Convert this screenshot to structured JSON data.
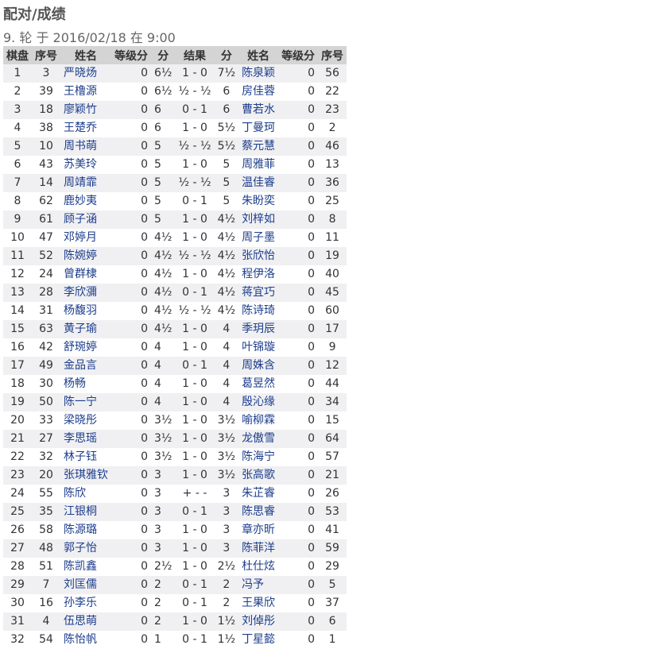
{
  "page": {
    "title": "配对/成绩",
    "round_info": "9. 轮 于 2016/02/18 在 9:00"
  },
  "table": {
    "headers": [
      "棋盘",
      "序号",
      "姓名",
      "等级分",
      "分",
      "结果",
      "分",
      "姓名",
      "等级分",
      "序号"
    ],
    "rows": [
      [
        "1",
        "3",
        "严晓炀",
        "0",
        "6½",
        "1 - 0",
        "7½",
        "陈泉颖",
        "0",
        "56"
      ],
      [
        "2",
        "39",
        "王橹源",
        "0",
        "6½",
        "½ - ½",
        "6",
        "房佳蓉",
        "0",
        "22"
      ],
      [
        "3",
        "18",
        "廖颖竹",
        "0",
        "6",
        "0 - 1",
        "6",
        "曹若水",
        "0",
        "23"
      ],
      [
        "4",
        "38",
        "王楚乔",
        "0",
        "6",
        "1 - 0",
        "5½",
        "丁曼珂",
        "0",
        "2"
      ],
      [
        "5",
        "10",
        "周书萌",
        "0",
        "5",
        "½ - ½",
        "5½",
        "蔡元慧",
        "0",
        "46"
      ],
      [
        "6",
        "43",
        "苏美玲",
        "0",
        "5",
        "1 - 0",
        "5",
        "周雅菲",
        "0",
        "13"
      ],
      [
        "7",
        "14",
        "周靖霏",
        "0",
        "5",
        "½ - ½",
        "5",
        "温佳睿",
        "0",
        "36"
      ],
      [
        "8",
        "62",
        "鹿妙夷",
        "0",
        "5",
        "0 - 1",
        "5",
        "朱盼奕",
        "0",
        "25"
      ],
      [
        "9",
        "61",
        "顾子涵",
        "0",
        "5",
        "1 - 0",
        "4½",
        "刘梓如",
        "0",
        "8"
      ],
      [
        "10",
        "47",
        "邓婷月",
        "0",
        "4½",
        "1 - 0",
        "4½",
        "周子墨",
        "0",
        "11"
      ],
      [
        "11",
        "52",
        "陈婉婷",
        "0",
        "4½",
        "½ - ½",
        "4½",
        "张欣怡",
        "0",
        "19"
      ],
      [
        "12",
        "24",
        "曾群棣",
        "0",
        "4½",
        "1 - 0",
        "4½",
        "程伊洛",
        "0",
        "40"
      ],
      [
        "13",
        "28",
        "李欣瀰",
        "0",
        "4½",
        "0 - 1",
        "4½",
        "蒋宜巧",
        "0",
        "45"
      ],
      [
        "14",
        "31",
        "杨馥羽",
        "0",
        "4½",
        "½ - ½",
        "4½",
        "陈诗琦",
        "0",
        "60"
      ],
      [
        "15",
        "63",
        "黄子瑜",
        "0",
        "4½",
        "1 - 0",
        "4",
        "季玥辰",
        "0",
        "17"
      ],
      [
        "16",
        "42",
        "舒琬婷",
        "0",
        "4",
        "1 - 0",
        "4",
        "叶锦璇",
        "0",
        "9"
      ],
      [
        "17",
        "49",
        "金品言",
        "0",
        "4",
        "0 - 1",
        "4",
        "周姝含",
        "0",
        "12"
      ],
      [
        "18",
        "30",
        "杨畅",
        "0",
        "4",
        "1 - 0",
        "4",
        "葛昱然",
        "0",
        "44"
      ],
      [
        "19",
        "50",
        "陈一宁",
        "0",
        "4",
        "1 - 0",
        "4",
        "殷沁缘",
        "0",
        "34"
      ],
      [
        "20",
        "33",
        "梁晓彤",
        "0",
        "3½",
        "1 - 0",
        "3½",
        "喻柳霖",
        "0",
        "15"
      ],
      [
        "21",
        "27",
        "李思瑶",
        "0",
        "3½",
        "1 - 0",
        "3½",
        "龙傲雪",
        "0",
        "64"
      ],
      [
        "22",
        "32",
        "林子钰",
        "0",
        "3½",
        "1 - 0",
        "3½",
        "陈海宁",
        "0",
        "57"
      ],
      [
        "23",
        "20",
        "张琪雅钦",
        "0",
        "3",
        "1 - 0",
        "3½",
        "张高歌",
        "0",
        "21"
      ],
      [
        "24",
        "55",
        "陈欣",
        "0",
        "3",
        "+ - -",
        "3",
        "朱芷睿",
        "0",
        "26"
      ],
      [
        "25",
        "35",
        "江银桐",
        "0",
        "3",
        "0 - 1",
        "3",
        "陈思睿",
        "0",
        "53"
      ],
      [
        "26",
        "58",
        "陈源璐",
        "0",
        "3",
        "1 - 0",
        "3",
        "章亦昕",
        "0",
        "41"
      ],
      [
        "27",
        "48",
        "郭子怡",
        "0",
        "3",
        "1 - 0",
        "3",
        "陈菲洋",
        "0",
        "59"
      ],
      [
        "28",
        "51",
        "陈凯鑫",
        "0",
        "2½",
        "1 - 0",
        "2½",
        "杜仕炫",
        "0",
        "29"
      ],
      [
        "29",
        "7",
        "刘匡儒",
        "0",
        "2",
        "0 - 1",
        "2",
        "冯予",
        "0",
        "5"
      ],
      [
        "30",
        "16",
        "孙李乐",
        "0",
        "2",
        "0 - 1",
        "2",
        "王果欣",
        "0",
        "37"
      ],
      [
        "31",
        "4",
        "伍思萌",
        "0",
        "2",
        "1 - 0",
        "1½",
        "刘倬彤",
        "0",
        "6"
      ],
      [
        "32",
        "54",
        "陈怡帆",
        "0",
        "1",
        "0 - 1",
        "1½",
        "丁星懿",
        "0",
        "1"
      ]
    ]
  }
}
